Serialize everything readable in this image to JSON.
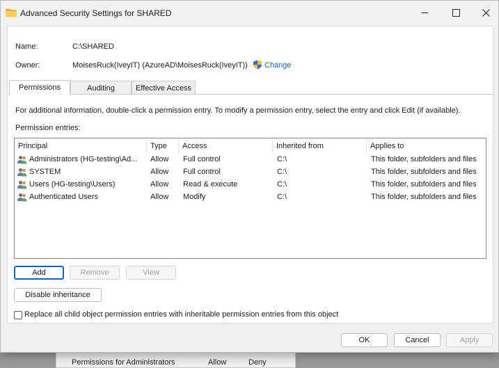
{
  "window": {
    "title": "Advanced Security Settings for SHARED",
    "minimize": "—",
    "maximize": "☐",
    "close": "✕"
  },
  "info": {
    "name_label": "Name:",
    "name_value": "C:\\SHARED",
    "owner_label": "Owner:",
    "owner_value": "MoisesRuck(IveyIT) (AzureAD\\MoisesRuck(IveyIT))",
    "change_label": "Change"
  },
  "tabs": [
    {
      "label": "Permissions",
      "active": true
    },
    {
      "label": "Auditing",
      "active": false
    },
    {
      "label": "Effective Access",
      "active": false
    }
  ],
  "instructions": "For additional information, double-click a permission entry. To modify a permission entry, select the entry and click Edit (if available).",
  "entries_label": "Permission entries:",
  "columns": [
    "Principal",
    "Type",
    "Access",
    "Inherited from",
    "Applies to"
  ],
  "rows": [
    {
      "principal": "Administrators (HG-testing\\Ad...",
      "type": "Allow",
      "access": "Full control",
      "inherited": "C:\\",
      "applies": "This folder, subfolders and files"
    },
    {
      "principal": "SYSTEM",
      "type": "Allow",
      "access": "Full control",
      "inherited": "C:\\",
      "applies": "This folder, subfolders and files"
    },
    {
      "principal": "Users (HG-testing\\Users)",
      "type": "Allow",
      "access": "Read & execute",
      "inherited": "C:\\",
      "applies": "This folder, subfolders and files"
    },
    {
      "principal": "Authenticated Users",
      "type": "Allow",
      "access": "Modify",
      "inherited": "C:\\",
      "applies": "This folder, subfolders and files"
    }
  ],
  "buttons": {
    "add": "Add",
    "remove": "Remove",
    "view": "View",
    "disable_inheritance": "Disable inheritance",
    "ok": "OK",
    "cancel": "Cancel",
    "apply": "Apply"
  },
  "replace_checkbox": {
    "label": "Replace all child object permission entries with inheritable permission entries from this object",
    "checked": false
  },
  "background_window": {
    "label": "Permissions for Administrators",
    "allow": "Allow",
    "deny": "Deny"
  },
  "colors": {
    "link": "#1c5fb8",
    "default_button_border": "#0067c0",
    "folder_icon": "#e8b53a"
  }
}
